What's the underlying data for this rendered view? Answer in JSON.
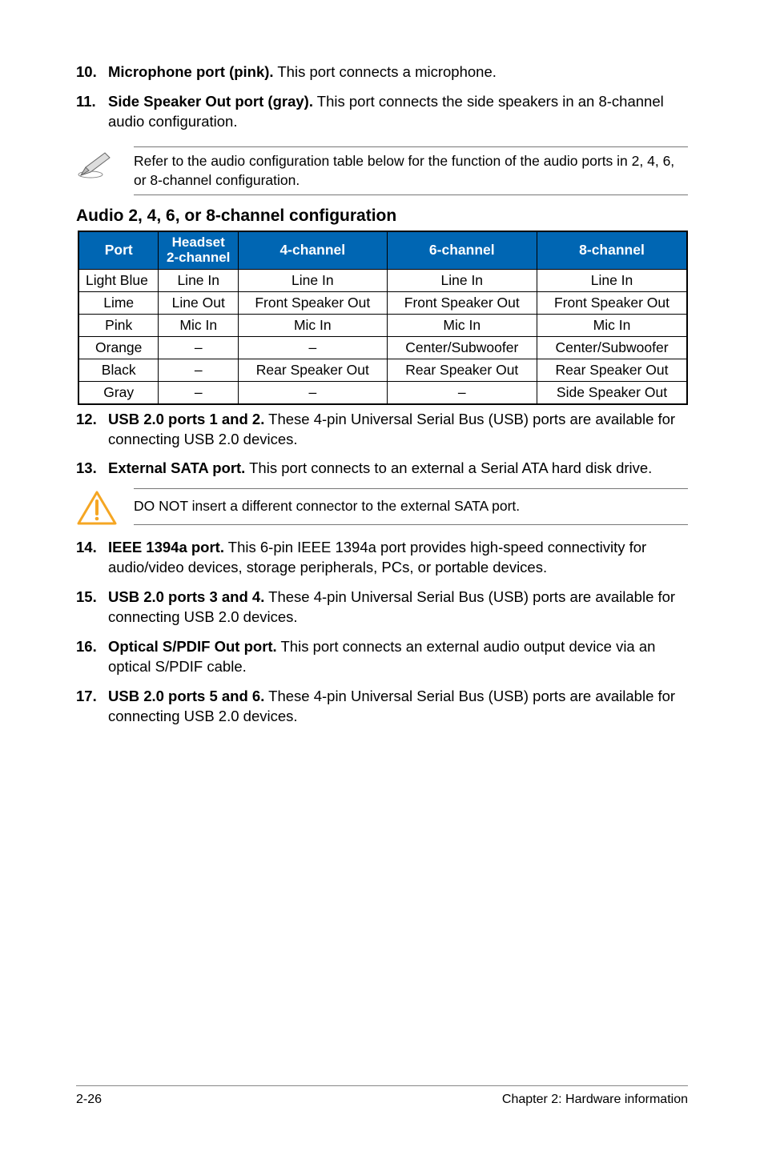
{
  "items_top": [
    {
      "num": "10.",
      "lead": "Microphone port (pink).",
      "rest": " This port connects a microphone."
    },
    {
      "num": "11.",
      "lead": "Side Speaker Out port (gray).",
      "rest": " This port connects the side speakers in an 8-channel audio configuration."
    }
  ],
  "note1": "Refer to the audio configuration table below for the function of the audio ports in 2, 4, 6, or 8-channel configuration.",
  "table_title": "Audio 2, 4, 6, or 8-channel configuration",
  "chart_data": {
    "type": "table",
    "headers": [
      "Port",
      "Headset 2-channel",
      "4-channel",
      "6-channel",
      "8-channel"
    ],
    "rows": [
      [
        "Light Blue",
        "Line In",
        "Line In",
        "Line In",
        "Line In"
      ],
      [
        "Lime",
        "Line Out",
        "Front Speaker Out",
        "Front Speaker Out",
        "Front Speaker Out"
      ],
      [
        "Pink",
        "Mic In",
        "Mic In",
        "Mic In",
        "Mic In"
      ],
      [
        "Orange",
        "–",
        "–",
        "Center/Subwoofer",
        "Center/Subwoofer"
      ],
      [
        "Black",
        "–",
        "Rear Speaker Out",
        "Rear Speaker Out",
        "Rear Speaker Out"
      ],
      [
        "Gray",
        "–",
        "–",
        "–",
        "Side Speaker Out"
      ]
    ]
  },
  "items_mid": [
    {
      "num": "12.",
      "lead": "USB 2.0 ports 1 and 2.",
      "rest": " These 4-pin Universal Serial Bus (USB) ports are available for connecting USB 2.0 devices."
    },
    {
      "num": "13.",
      "lead": "External SATA port.",
      "rest": " This port connects to an external a Serial ATA hard disk drive."
    }
  ],
  "note2": "DO NOT insert a different connector to the external SATA port.",
  "items_bot": [
    {
      "num": "14.",
      "lead": "IEEE 1394a port.",
      "rest": " This 6-pin IEEE 1394a port provides high-speed connectivity for audio/video devices, storage peripherals, PCs, or portable devices."
    },
    {
      "num": "15.",
      "lead": "USB 2.0 ports 3 and 4.",
      "rest": " These 4-pin Universal Serial Bus (USB) ports are available for connecting USB 2.0 devices."
    },
    {
      "num": "16.",
      "lead": "Optical S/PDIF Out port.",
      "rest": " This port connects an external audio output device via an optical S/PDIF cable."
    },
    {
      "num": "17.",
      "lead": "USB 2.0 ports 5 and 6.",
      "rest": " These 4-pin Universal Serial Bus (USB) ports are available for connecting USB 2.0 devices."
    }
  ],
  "footer": {
    "left": "2-26",
    "right": "Chapter 2: Hardware information"
  }
}
